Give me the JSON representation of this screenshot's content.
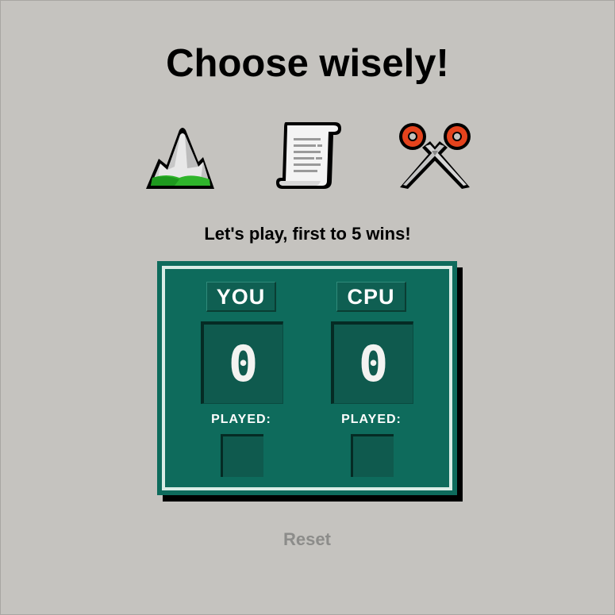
{
  "title": "Choose wisely!",
  "choices": [
    {
      "id": "rock",
      "icon": "mountain-icon"
    },
    {
      "id": "paper",
      "icon": "scroll-icon"
    },
    {
      "id": "scissors",
      "icon": "scissors-icon"
    }
  ],
  "status": "Let's play, first to 5 wins!",
  "scoreboard": {
    "player": {
      "label": "YOU",
      "score": "0",
      "played_label": "PLAYED:",
      "played": ""
    },
    "cpu": {
      "label": "CPU",
      "score": "0",
      "played_label": "PLAYED:",
      "played": ""
    }
  },
  "reset_label": "Reset",
  "colors": {
    "background": "#c5c3bf",
    "board": "#0e6b5c",
    "board_border": "#d9ece6",
    "reset_text": "#8c8c8a"
  }
}
